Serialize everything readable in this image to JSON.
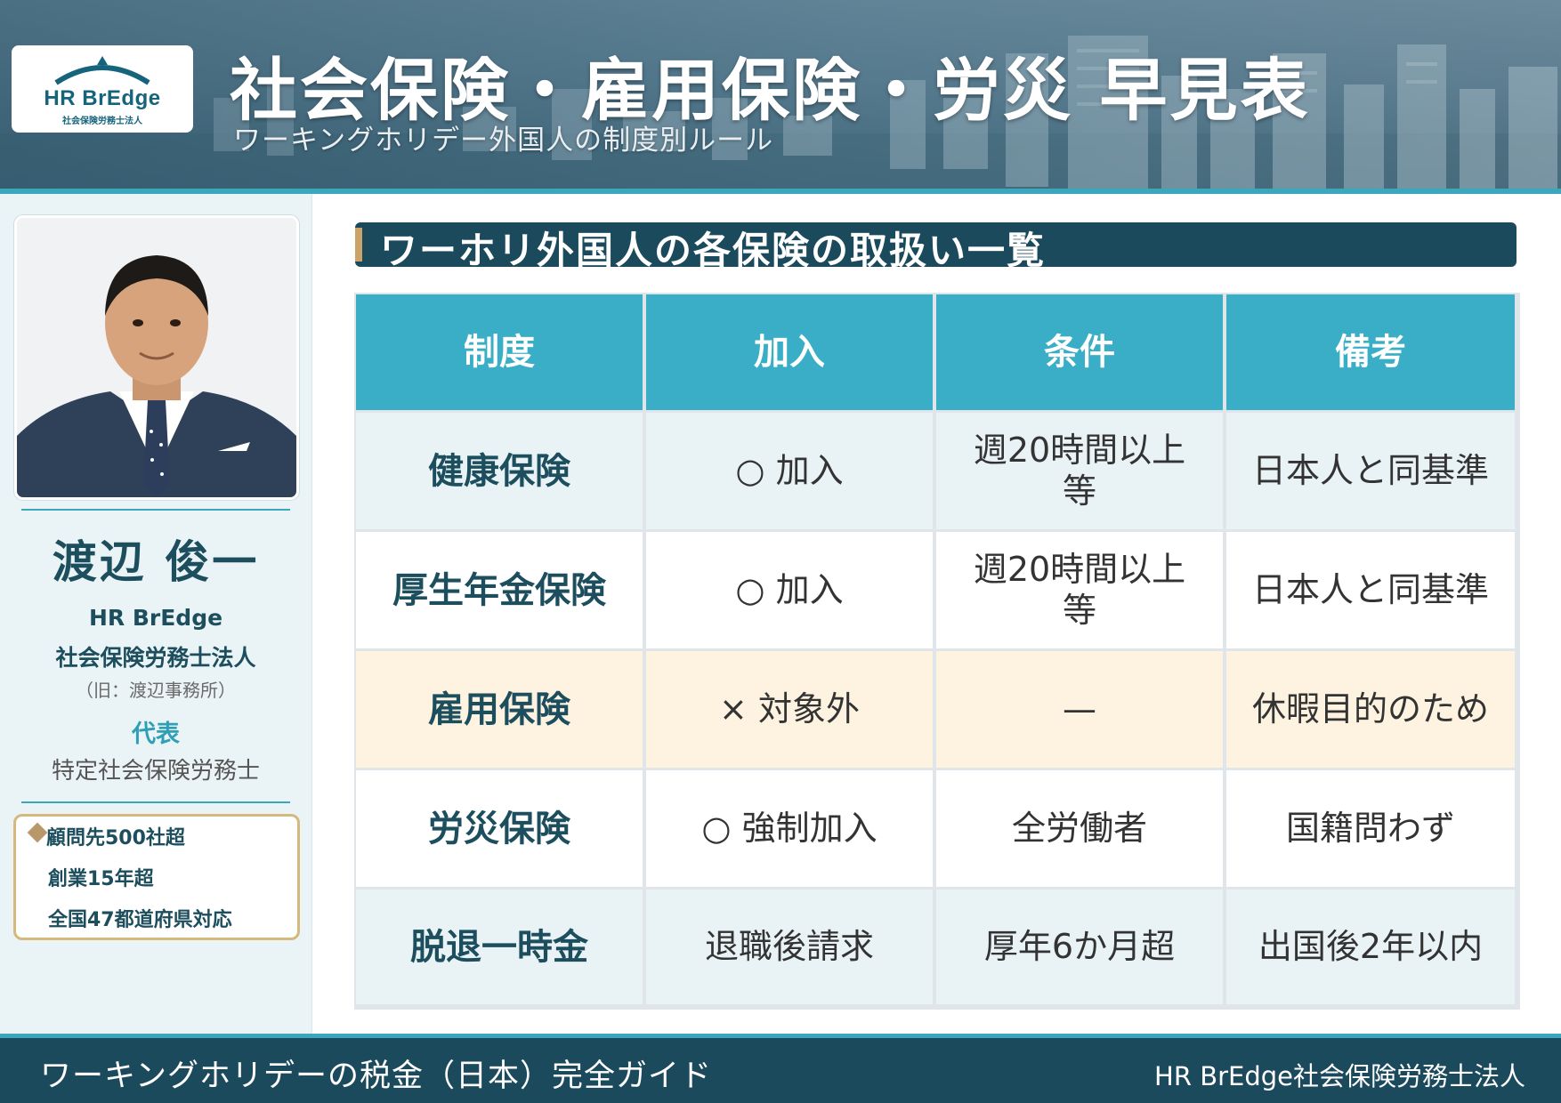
{
  "header": {
    "logo_text": "HR BrEdge",
    "logo_sub": "社会保険労務士法人",
    "title": "社会保険・雇用保険・労災 早見表",
    "subtitle": "ワーキングホリデー外国人の制度別ルール"
  },
  "profile": {
    "name": "渡辺 俊一",
    "org_line1": "HR BrEdge",
    "org_line2": "社会保険労務士法人",
    "former_name": "（旧：渡辺事務所）",
    "role": "代表",
    "qualification": "特定社会保険労務士",
    "highlights": [
      "顧問先500社超",
      "創業15年超",
      "全国47都道府県対応"
    ]
  },
  "section": {
    "title": "ワーホリ外国人の各保険の取扱い一覧"
  },
  "table": {
    "headers": [
      "制度",
      "加入",
      "条件",
      "備考"
    ],
    "rows": [
      {
        "name": "健康保険",
        "join": "○ 加入",
        "condition": "週20時間以上等",
        "note": "日本人と同基準"
      },
      {
        "name": "厚生年金保険",
        "join": "○ 加入",
        "condition": "週20時間以上等",
        "note": "日本人と同基準"
      },
      {
        "name": "雇用保険",
        "join": "× 対象外",
        "condition": "—",
        "note": "休暇目的のため"
      },
      {
        "name": "労災保険",
        "join": "○ 強制加入",
        "condition": "全労働者",
        "note": "国籍問わず"
      },
      {
        "name": "脱退一時金",
        "join": "退職後請求",
        "condition": "厚年6か月超",
        "note": "出国後2年以内"
      }
    ]
  },
  "footer": {
    "left": "ワーキングホリデーの税金（日本）完全ガイド",
    "right": "HR BrEdge社会保険労務士法人"
  },
  "colors": {
    "header_cell": "#3aaec6",
    "navy": "#1c4a5d",
    "row_blue": "#e9f3f6",
    "row_cream": "#fdf3e0",
    "gold": "#d6b87a"
  }
}
